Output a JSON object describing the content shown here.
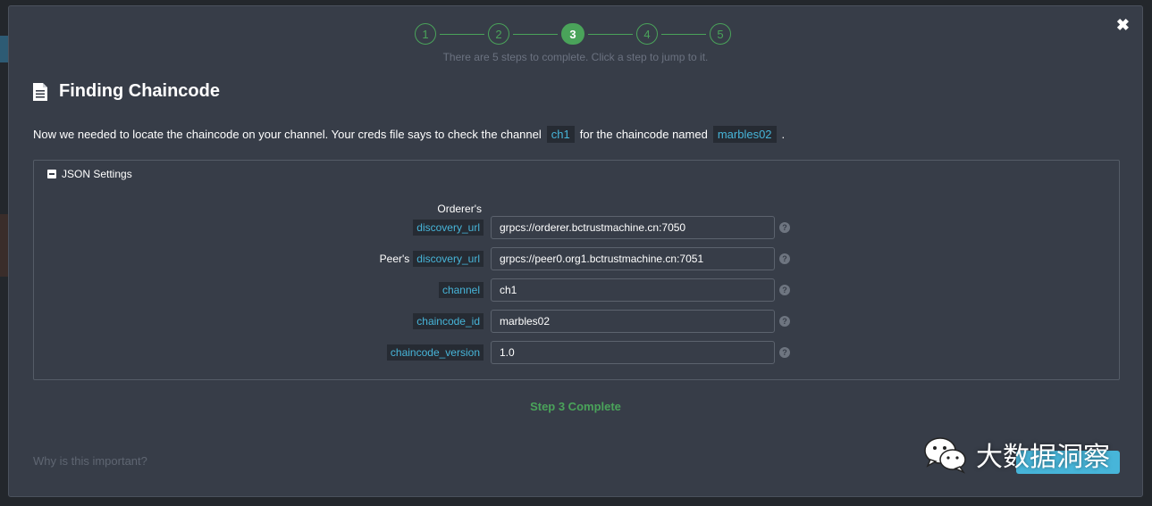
{
  "stepper": {
    "steps": [
      "1",
      "2",
      "3",
      "4",
      "5"
    ],
    "active_step": 3,
    "hint": "There are 5 steps to complete. Click a step to jump to it."
  },
  "close_label": "✖",
  "title": "Finding Chaincode",
  "description": {
    "before": "Now we needed to locate the chaincode on your channel. Your creds file says to check the channel",
    "channel": "ch1",
    "middle": "for the chaincode named",
    "chaincode": "marbles02",
    "after": "."
  },
  "panel": {
    "toggle_label": "JSON Settings",
    "fields": [
      {
        "prefix": "Orderer's",
        "key": "discovery_url",
        "value": "grpcs://orderer.bctrustmachine.cn:7050"
      },
      {
        "prefix": "Peer's",
        "key": "discovery_url",
        "value": "grpcs://peer0.org1.bctrustmachine.cn:7051"
      },
      {
        "prefix": "",
        "key": "channel",
        "value": "ch1"
      },
      {
        "prefix": "",
        "key": "chaincode_id",
        "value": "marbles02"
      },
      {
        "prefix": "",
        "key": "chaincode_version",
        "value": "1.0"
      }
    ],
    "help_glyph": "?"
  },
  "status": "Step 3 Complete",
  "why_link": "Why is this important?",
  "watermark": "大数据洞察",
  "colors": {
    "accent_green": "#4aa35a",
    "code_blue": "#47b5d9",
    "modal_bg": "#373d48"
  }
}
